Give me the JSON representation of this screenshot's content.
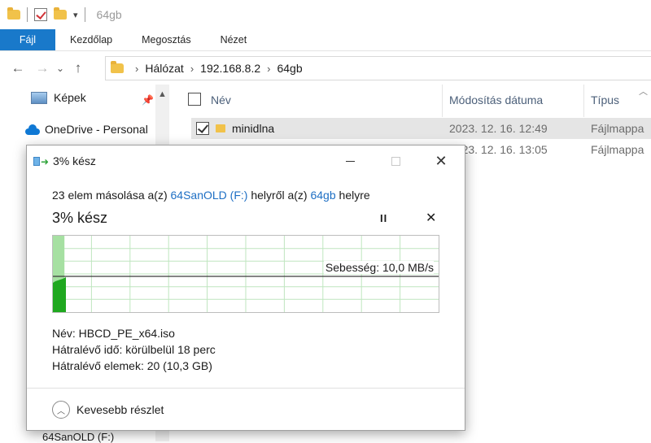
{
  "titlebar": {
    "title": "64gb",
    "dropdown_glyph": "▾"
  },
  "ribbon": {
    "tabs": [
      "Fájl",
      "Kezdőlap",
      "Megosztás",
      "Nézet"
    ]
  },
  "address": {
    "path": [
      "Hálózat",
      "192.168.8.2",
      "64gb"
    ]
  },
  "navpane": {
    "items": [
      {
        "label": "Képek",
        "icon": "pictures-icon",
        "pinned": true
      },
      {
        "label": "OneDrive - Personal",
        "icon": "onedrive-cloud-icon"
      }
    ],
    "peek_label": "64SanOLD (F:)"
  },
  "filelist": {
    "columns": [
      "Név",
      "Módosítás dátuma",
      "Típus"
    ],
    "rows": [
      {
        "name": "minidlna",
        "date": "2023. 12. 16. 12:49",
        "type": "Fájlmappa",
        "selected": true
      },
      {
        "name": "",
        "date": "2023. 12. 16. 13:05",
        "type": "Fájlmappa",
        "selected": false
      }
    ]
  },
  "dialog": {
    "title": "3% kész",
    "line_prefix": "23 elem másolása a(z) ",
    "source": "64SanOLD (F:)",
    "line_mid": " helyről a(z) ",
    "destination": "64gb",
    "line_suffix": " helyre",
    "status": "3% kész",
    "progress_percent": 3,
    "speed_label": "Sebesség: 10,0 MB/s",
    "name_line": "Név: HBCD_PE_x64.iso",
    "time_line": "Hátralévő idő: körülbelül 18 perc",
    "items_line": "Hátralévő elemek: 20 (10,3 GB)",
    "less_details": "Kevesebb részlet",
    "pause_glyph": "II",
    "cancel_glyph": "✕"
  },
  "colors": {
    "accent": "#1979ca",
    "link": "#1e6fc4",
    "graph_fill": "#2db82d"
  }
}
